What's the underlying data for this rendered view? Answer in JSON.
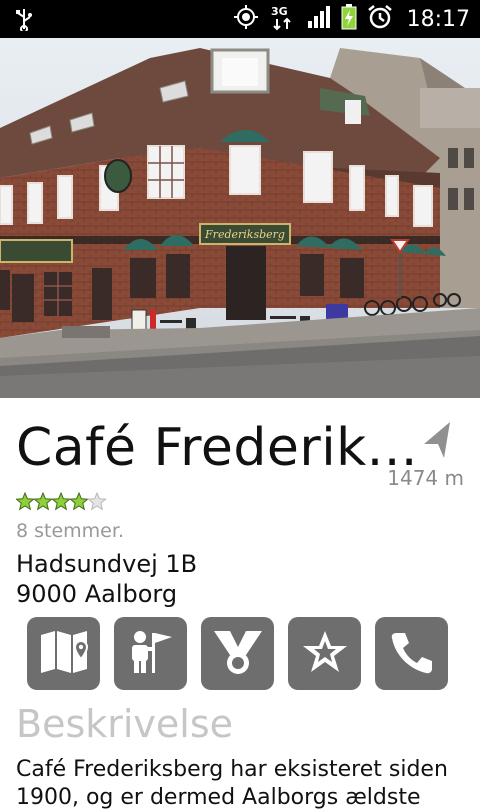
{
  "status_bar": {
    "time": "18:17",
    "network": "3G",
    "icons": [
      "usb-icon",
      "gps-icon",
      "network-3g-icon",
      "signal-icon",
      "battery-icon",
      "alarm-icon"
    ]
  },
  "place": {
    "name": "Café Frederik...",
    "distance": "1474 m",
    "rating": {
      "value": 4,
      "max": 5
    },
    "votes": "8 stemmer.",
    "address_line1": "Hadsundvej 1B",
    "address_line2": "9000 Aalborg",
    "photo_signs": {
      "main": "Frederiksberg"
    }
  },
  "actions": [
    {
      "icon": "map-icon"
    },
    {
      "icon": "guide-icon"
    },
    {
      "icon": "badge-icon"
    },
    {
      "icon": "favorite-star-icon"
    },
    {
      "icon": "phone-icon"
    }
  ],
  "description": {
    "title": "Beskrivelse",
    "text": "Café Frederiksberg har eksisteret siden 1900, og er dermed Aalborgs ældste"
  },
  "colors": {
    "star": "#8fcf3c",
    "button": "#6e6e6e",
    "section_title": "#c6c6c6"
  }
}
